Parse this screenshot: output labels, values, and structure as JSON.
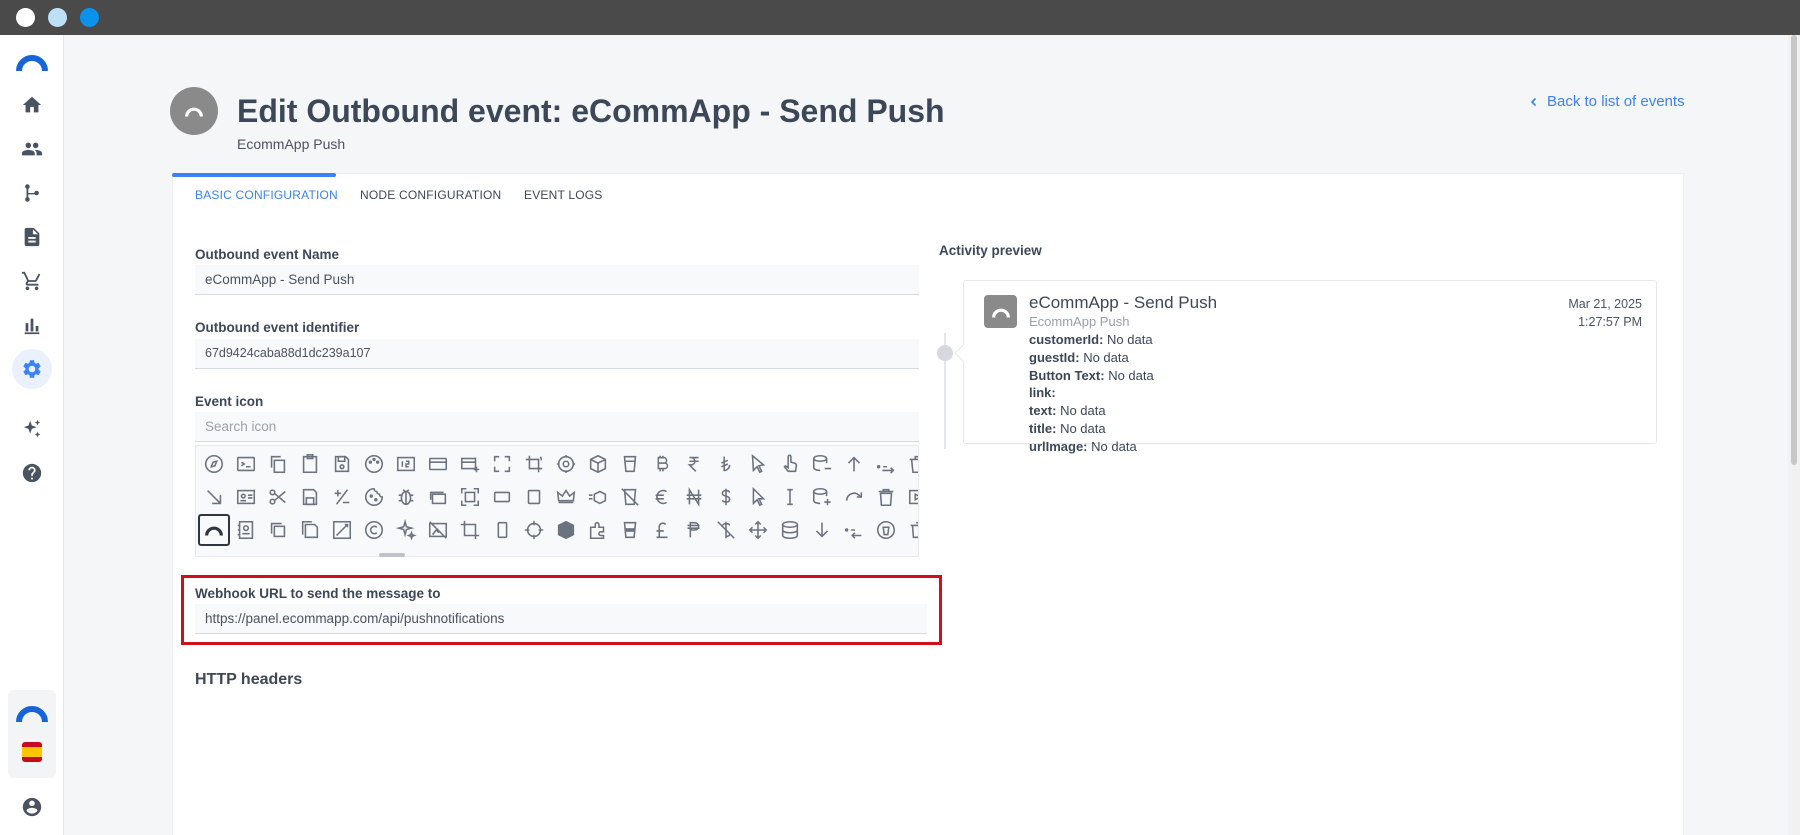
{
  "window": {
    "dot_colors": [
      "#ffffff",
      "#bde0f7",
      "#0a92ec"
    ]
  },
  "colors": {
    "accent": "#3b82f6",
    "highlight": "#d10f1c",
    "icon_gray": "#8a8a8a"
  },
  "sidebar": {
    "items": [
      {
        "name": "home",
        "icon": "home-icon"
      },
      {
        "name": "users",
        "icon": "people-icon"
      },
      {
        "name": "flows",
        "icon": "branch-icon"
      },
      {
        "name": "documents",
        "icon": "document-icon"
      },
      {
        "name": "commerce",
        "icon": "cart-icon"
      },
      {
        "name": "analytics",
        "icon": "bar-chart-icon"
      },
      {
        "name": "settings",
        "icon": "gear-icon"
      },
      {
        "name": "ai",
        "icon": "sparkles-icon"
      },
      {
        "name": "help",
        "icon": "help-icon"
      }
    ],
    "bottom": [
      "logo-icon",
      "spain-flag-icon",
      "account-icon"
    ]
  },
  "header": {
    "title": "Edit Outbound event: eCommApp - Send Push",
    "subtitle": "EcommApp Push",
    "back_link": "Back to list of events"
  },
  "tabs": [
    {
      "label": "BASIC CONFIGURATION",
      "active": true
    },
    {
      "label": "NODE CONFIGURATION",
      "active": false
    },
    {
      "label": "EVENT LOGS",
      "active": false
    }
  ],
  "form": {
    "name_label": "Outbound event Name",
    "name_value": "eCommApp - Send Push",
    "identifier_label": "Outbound event identifier",
    "identifier_value": "67d9424caba88d1dc239a107",
    "icon_label": "Event icon",
    "icon_search_placeholder": "Search icon",
    "webhook_label": "Webhook URL to send the message to",
    "webhook_value": "https://panel.ecommapp.com/api/pushnotifications",
    "headers_title": "HTTP headers"
  },
  "icon_grid": {
    "rows": [
      [
        "compass-icon",
        "terminal-icon",
        "copy-icon",
        "clipboard-icon",
        "save-icon",
        "palette-icon",
        "number-icon",
        "credit-card-icon",
        "add-card-icon",
        "fullscreen-icon",
        "crop-rotate-icon",
        "target-icon",
        "cube-icon",
        "cup-icon",
        "bitcoin-icon",
        "rupee-icon",
        "lira-icon",
        "cursor-icon",
        "hand-pointer-icon",
        "database-minus-icon",
        "arrow-up-icon",
        "decimal-increase-icon",
        "trash-icon"
      ],
      [
        "resize-icon",
        "id-card-icon",
        "scissors-icon",
        "save-alt-icon",
        "plus-minus-icon",
        "cookie-icon",
        "bug-icon",
        "layers-icon",
        "fit-icon",
        "rectangle-icon",
        "square-icon",
        "crown-icon",
        "cube-move-icon",
        "no-cup-icon",
        "euro-icon",
        "naira-icon",
        "dollar-icon",
        "pointer-icon",
        "text-cursor-icon",
        "database-plus-icon",
        "redo-icon",
        "delete-icon",
        "cast-icon"
      ],
      [
        "half-dome-icon",
        "contact-icon",
        "copy-alt-icon",
        "save-all-icon",
        "image-edit-icon",
        "copyright-icon",
        "sparkle-icon",
        "image-off-icon",
        "crop-icon",
        "portrait-icon",
        "crosshair-icon",
        "box-icon",
        "puzzle-icon",
        "cup-full-icon",
        "pound-icon",
        "peso-icon",
        "no-dollar-icon",
        "move-icon",
        "database-icon",
        "arrow-down-icon",
        "decimal-decrease-icon",
        "recycle-icon",
        "trash-outline-icon"
      ]
    ],
    "selected": "half-dome-icon"
  },
  "preview": {
    "label": "Activity preview",
    "title": "eCommApp - Send Push",
    "subtitle": "EcommApp Push",
    "date": "Mar 21, 2025",
    "time": "1:27:57 PM",
    "fields": [
      {
        "key": "customerId:",
        "value": "No data"
      },
      {
        "key": "guestId:",
        "value": "No data"
      },
      {
        "key": "Button Text:",
        "value": "No data"
      },
      {
        "key": "link:",
        "value": ""
      },
      {
        "key": "text:",
        "value": "No data"
      },
      {
        "key": "title:",
        "value": "No data"
      },
      {
        "key": "urlImage:",
        "value": "No data"
      }
    ]
  }
}
